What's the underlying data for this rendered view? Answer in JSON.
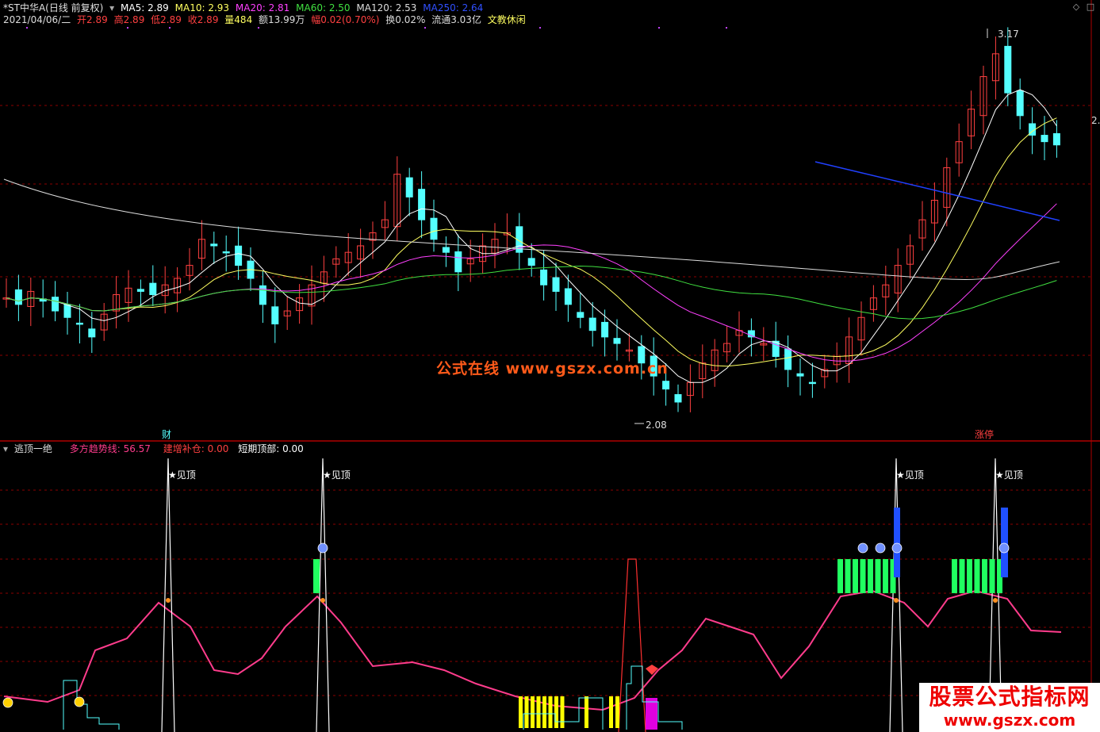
{
  "main_header": {
    "symbol": "*ST中华A(日线 前复权)",
    "ma5": "MA5: 2.89",
    "ma10": "MA10: 2.93",
    "ma20": "MA20: 2.81",
    "ma60": "MA60: 2.50",
    "ma120": "MA120: 2.53",
    "ma250": "MA250: 2.64"
  },
  "info_line": {
    "date": "2021/04/06/二",
    "open": "开2.89",
    "high": "高2.89",
    "low": "低2.89",
    "close": "收2.89",
    "volume": "量484",
    "amount": "额13.99万",
    "change": "幅0.02(0.70%)",
    "turnover": "换0.02%",
    "float_cap": "流通3.03亿",
    "sector": "文教休闲"
  },
  "annotations": {
    "high_price": "3.17",
    "low_price": "2.08",
    "cai_marker": "财",
    "zhangting_marker": "涨停",
    "right_axis_label": "2."
  },
  "sub_header": {
    "indicator_name": "逃顶一绝",
    "trend_label": "多方趋势线:",
    "trend_value": "56.57",
    "build_label": "建增补仓:",
    "build_value": "0.00",
    "top_label": "短期顶部:",
    "top_value": "0.00"
  },
  "signals": {
    "top_signal": "见顶"
  },
  "watermark": {
    "text": "公式在线  www.gszx.com.cn"
  },
  "corner_logo": {
    "title": "股票公式指标网",
    "url": "www.gszx.com"
  },
  "colors": {
    "bg": "#000000",
    "up": "#ff4040",
    "down": "#54ffff",
    "ma5": "#ffffff",
    "ma10": "#ffff60",
    "ma20": "#ff40ff",
    "ma60": "#40e040",
    "ma120": "#dddddd",
    "ma250": "#2040ff",
    "trend": "#ff3c8c",
    "grid": "#8b0000",
    "signal_green": "#20ff60",
    "signal_blue": "#2050ff",
    "signal_yellow": "#ffff00",
    "signal_magenta": "#e000e0"
  },
  "chart_data": {
    "type": "candlestick",
    "price_range": [
      2.0,
      3.25
    ],
    "series": [
      {
        "name": "K线",
        "ohlc_note": "daily candles, ~100 bars",
        "range": [
          2.08,
          3.17
        ]
      }
    ]
  }
}
